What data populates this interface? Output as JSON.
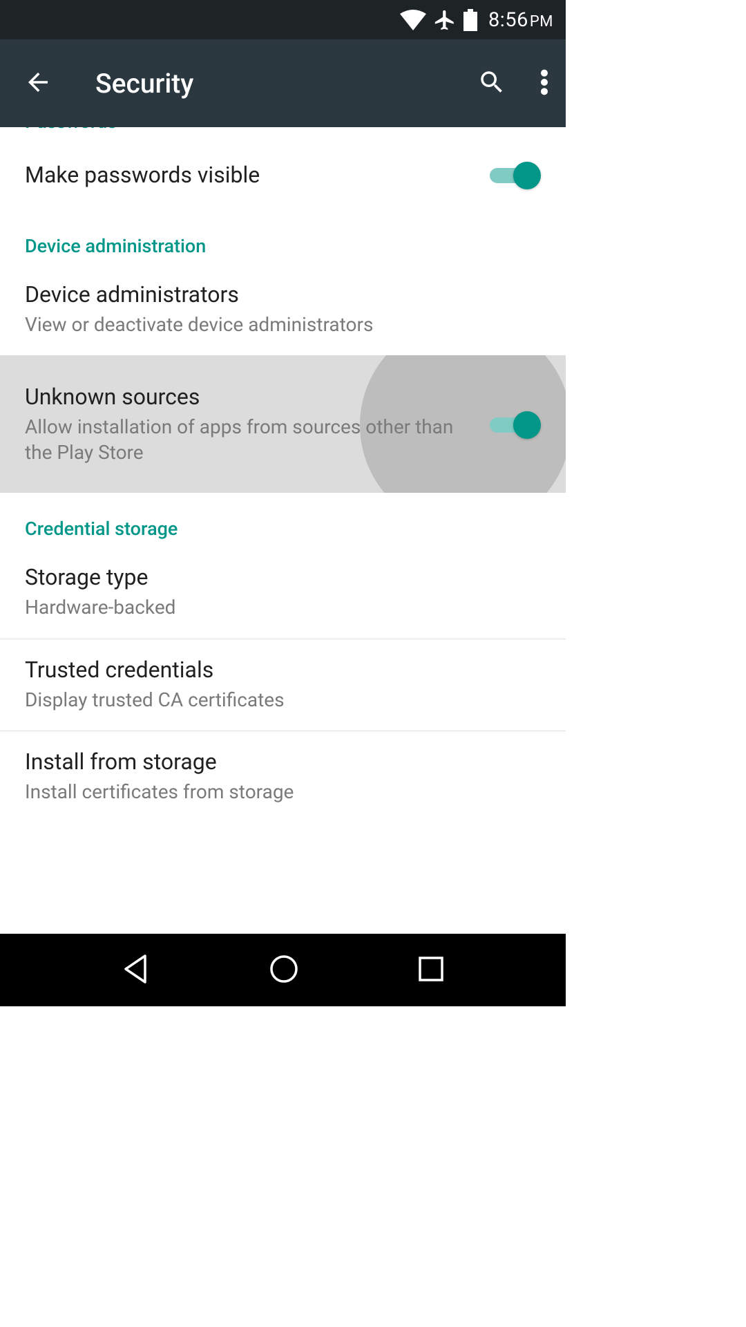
{
  "status_bar": {
    "time": "8:56",
    "ampm": "PM"
  },
  "app_bar": {
    "title": "Security"
  },
  "sections": {
    "passwords": {
      "header": "Passwords",
      "make_visible": "Make passwords visible"
    },
    "device_admin": {
      "header": "Device administration",
      "administrators": {
        "title": "Device administrators",
        "sub": "View or deactivate device administrators"
      },
      "unknown_sources": {
        "title": "Unknown sources",
        "sub": "Allow installation of apps from sources other than the Play Store"
      }
    },
    "credential_storage": {
      "header": "Credential storage",
      "storage_type": {
        "title": "Storage type",
        "sub": "Hardware-backed"
      },
      "trusted_credentials": {
        "title": "Trusted credentials",
        "sub": "Display trusted CA certificates"
      },
      "install_storage": {
        "title": "Install from storage",
        "sub": "Install certificates from storage"
      }
    }
  },
  "colors": {
    "accent": "#009688"
  }
}
